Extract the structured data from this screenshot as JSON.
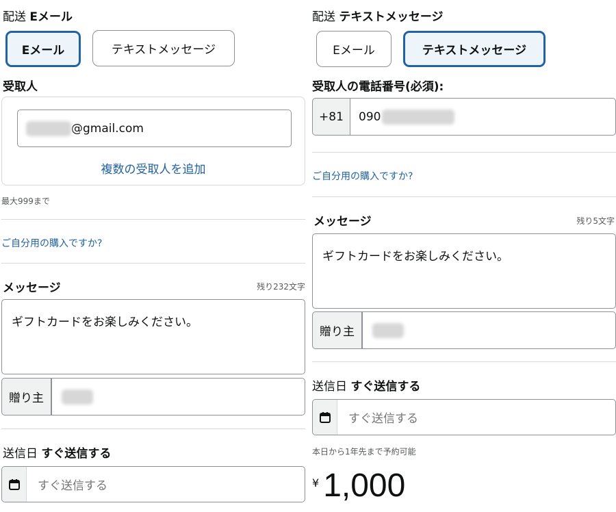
{
  "left": {
    "delivery_label": "配送",
    "delivery_value": "Eメール",
    "tab_email": "Eメール",
    "tab_text": "テキストメッセージ",
    "recipient_heading": "受取人",
    "recipient_email_suffix": "@gmail.com",
    "add_recipients": "複数の受取人を追加",
    "max_note": "最大999まで",
    "self_purchase": "ご自分用の購入ですか?",
    "message_heading": "メッセージ",
    "chars_left": "残り232文字",
    "message_text": "ギフトカードをお楽しみください。",
    "sender_label": "贈り主",
    "send_date_label": "送信日",
    "send_date_value": "すぐ送信する",
    "date_placeholder": "すぐ送信する"
  },
  "right": {
    "delivery_label": "配送",
    "delivery_value": "テキストメッセージ",
    "tab_email": "Eメール",
    "tab_text": "テキストメッセージ",
    "phone_heading": "受取人の電話番号(必須):",
    "country_code": "+81",
    "phone_prefix": "090",
    "self_purchase": "ご自分用の購入ですか?",
    "message_heading": "メッセージ",
    "chars_left": "残り5文字",
    "message_text": "ギフトカードをお楽しみください。",
    "sender_label": "贈り主",
    "send_date_label": "送信日",
    "send_date_value": "すぐ送信する",
    "date_placeholder": "すぐ送信する",
    "schedule_note": "本日から1年先まで予約可能",
    "currency_symbol": "¥",
    "amount": "1,000"
  },
  "icons": {
    "calendar": "calendar-icon"
  },
  "colors": {
    "link": "#2162a1",
    "selected_border": "#2162a1",
    "selected_bg": "#edf5fb"
  }
}
